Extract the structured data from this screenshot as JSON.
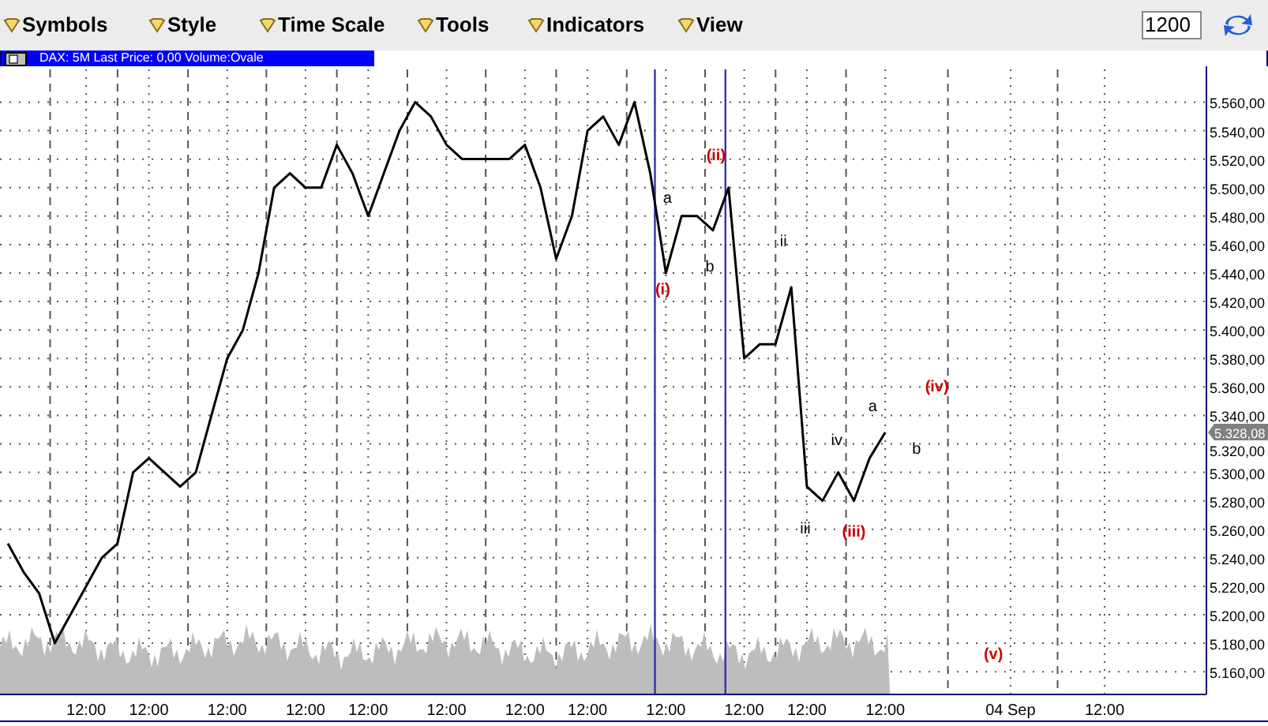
{
  "toolbar": {
    "menus": [
      {
        "label": "Symbols"
      },
      {
        "label": "Style"
      },
      {
        "label": "Time Scale"
      },
      {
        "label": "Tools"
      },
      {
        "label": "Indicators"
      },
      {
        "label": "View"
      }
    ],
    "bar_count": "1200"
  },
  "chart_window": {
    "title": "DAX: 5M Last Price: 0,00 Volume:Ovale",
    "last_price_tag": "5.328,08",
    "wave_labels": [
      {
        "text": "(i)",
        "color": "#cc0000"
      },
      {
        "text": "(ii)",
        "color": "#cc0000"
      },
      {
        "text": "a",
        "color": "#000000"
      },
      {
        "text": "b",
        "color": "#000000"
      },
      {
        "text": "ii",
        "color": "#000000"
      },
      {
        "text": "iii",
        "color": "#000000"
      },
      {
        "text": "iv",
        "color": "#000000"
      },
      {
        "text": "(iii)",
        "color": "#cc0000"
      },
      {
        "text": "a",
        "color": "#000000"
      },
      {
        "text": "b",
        "color": "#000000"
      },
      {
        "text": "(iv)",
        "color": "#cc0000"
      },
      {
        "text": "(v)",
        "color": "#cc0000"
      }
    ],
    "chart_data": {
      "type": "line",
      "ylim": [
        5144,
        5583
      ],
      "categories": [
        null,
        null,
        null,
        null,
        null,
        "12:00",
        null,
        null,
        null,
        "12:00",
        null,
        null,
        null,
        null,
        "12:00",
        null,
        null,
        null,
        null,
        "12:00",
        null,
        null,
        null,
        "12:00",
        null,
        null,
        null,
        null,
        "12:00",
        null,
        null,
        null,
        null,
        "12:00",
        null,
        null,
        null,
        "12:00",
        null,
        null,
        null,
        null,
        "12:00",
        null,
        null,
        null,
        null,
        "12:00",
        null,
        null,
        null,
        "12:00",
        null,
        null,
        null,
        null,
        "12:00",
        null,
        null,
        null,
        null,
        null,
        null,
        null,
        "04 Sep",
        null,
        null,
        null,
        null,
        null,
        "12:00",
        null,
        null,
        null,
        null,
        null,
        null
      ],
      "series": [
        {
          "color": "#000000",
          "values": [
            5250,
            5230,
            5215,
            5180,
            5200,
            5220,
            5240,
            5250,
            5300,
            5310,
            5300,
            5290,
            5300,
            5340,
            5380,
            5400,
            5440,
            5500,
            5510,
            5500,
            5500,
            5530,
            5510,
            5480,
            5510,
            5540,
            5560,
            5550,
            5530,
            5520,
            5520,
            5520,
            5520,
            5530,
            5500,
            5450,
            5480,
            5540,
            5550,
            5530,
            5560,
            5510,
            5440,
            5480,
            5480,
            5470,
            5500,
            5380,
            5390,
            5390,
            5430,
            5290,
            5280,
            5300,
            5280,
            5310,
            5328,
            null,
            null,
            null,
            null,
            null,
            null,
            null,
            null,
            null,
            null,
            null,
            null,
            null,
            null,
            null,
            null,
            null,
            null,
            null,
            null
          ]
        }
      ],
      "yticks": [
        {
          "value": 5560,
          "label": "5.560,00"
        },
        {
          "value": 5540,
          "label": "5.540,00"
        },
        {
          "value": 5520,
          "label": "5.520,00"
        },
        {
          "value": 5500,
          "label": "5.500,00"
        },
        {
          "value": 5480,
          "label": "5.480,00"
        },
        {
          "value": 5460,
          "label": "5.460,00"
        },
        {
          "value": 5440,
          "label": "5.440,00"
        },
        {
          "value": 5420,
          "label": "5.420,00"
        },
        {
          "value": 5400,
          "label": "5.400,00"
        },
        {
          "value": 5380,
          "label": "5.380,00"
        },
        {
          "value": 5360,
          "label": "5.360,00"
        },
        {
          "value": 5340,
          "label": "5.340,00"
        },
        {
          "value": 5320,
          "label": "5.320,00"
        },
        {
          "value": 5300,
          "label": "5.300,00"
        },
        {
          "value": 5280,
          "label": "5.280,00"
        },
        {
          "value": 5260,
          "label": "5.260,00"
        },
        {
          "value": 5240,
          "label": "5.240,00"
        },
        {
          "value": 5220,
          "label": "5.220,00"
        },
        {
          "value": 5200,
          "label": "5.200,00"
        },
        {
          "value": 5180,
          "label": "5.180,00"
        },
        {
          "value": 5160,
          "label": "5.160,00"
        }
      ],
      "grid": true
    }
  }
}
